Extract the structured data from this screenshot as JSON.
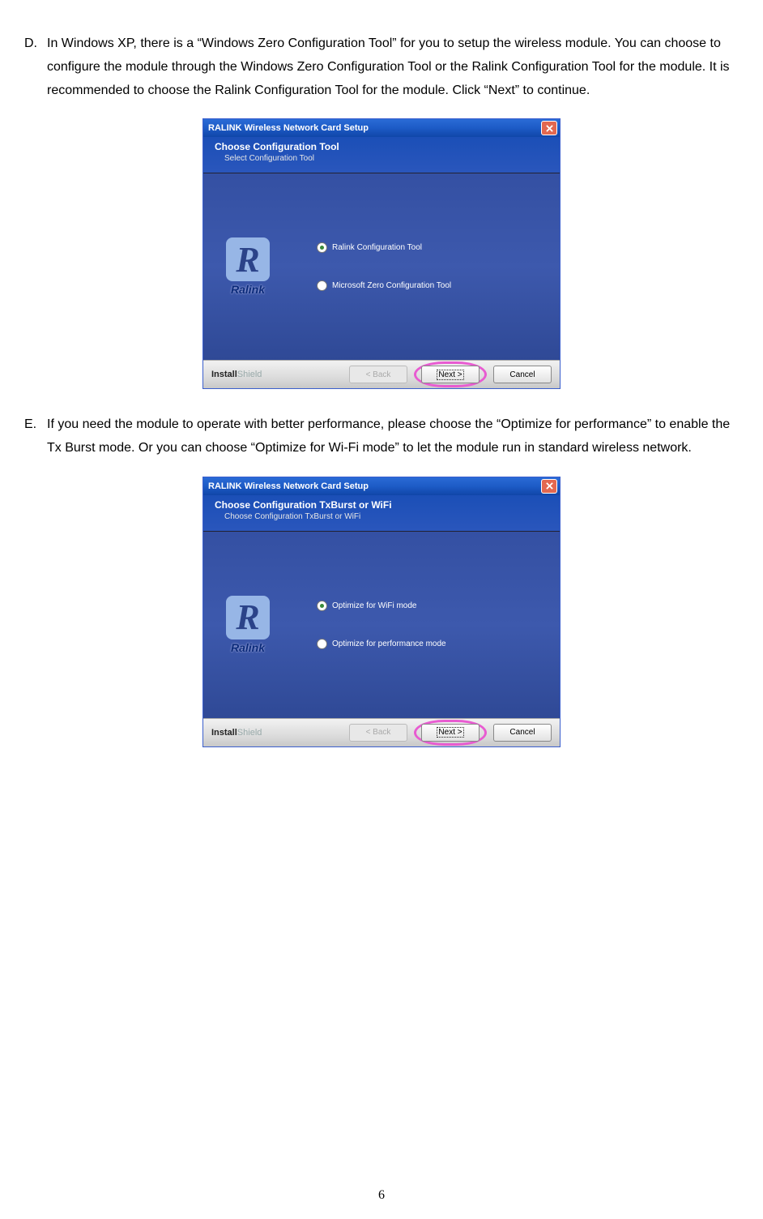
{
  "steps": [
    {
      "marker": "D.",
      "text": "In Windows XP, there is a “Windows Zero Configuration Tool” for you to setup the wireless module. You can choose to configure the module through the Windows Zero Configuration Tool or the Ralink Configuration Tool for the module. It is recommended to choose the Ralink Configuration Tool for the module. Click “Next” to continue."
    },
    {
      "marker": "E.",
      "text": "If you need the module to operate with better performance, please choose the “Optimize for performance” to enable the Tx Burst mode. Or you can choose “Optimize for Wi-Fi mode” to let the module run in standard wireless network."
    }
  ],
  "dialogs": [
    {
      "title": "RALINK Wireless Network Card Setup",
      "header_title": "Choose Configuration Tool",
      "header_sub": "Select Configuration Tool",
      "brand": "Ralink",
      "options": [
        {
          "label": "Ralink Configuration Tool",
          "selected": true
        },
        {
          "label": "Microsoft Zero Configuration Tool",
          "selected": false
        }
      ],
      "footer_brand_bold": "Install",
      "footer_brand_grey": "Shield",
      "back": "< Back",
      "next": "Next >",
      "cancel": "Cancel"
    },
    {
      "title": "RALINK Wireless Network Card Setup",
      "header_title": "Choose Configuration TxBurst or WiFi",
      "header_sub": "Choose Configuration TxBurst or WiFi",
      "brand": "Ralink",
      "options": [
        {
          "label": "Optimize for WiFi mode",
          "selected": true
        },
        {
          "label": "Optimize for performance mode",
          "selected": false
        }
      ],
      "footer_brand_bold": "Install",
      "footer_brand_grey": "Shield",
      "back": "< Back",
      "next": "Next >",
      "cancel": "Cancel"
    }
  ],
  "page_number": "6"
}
